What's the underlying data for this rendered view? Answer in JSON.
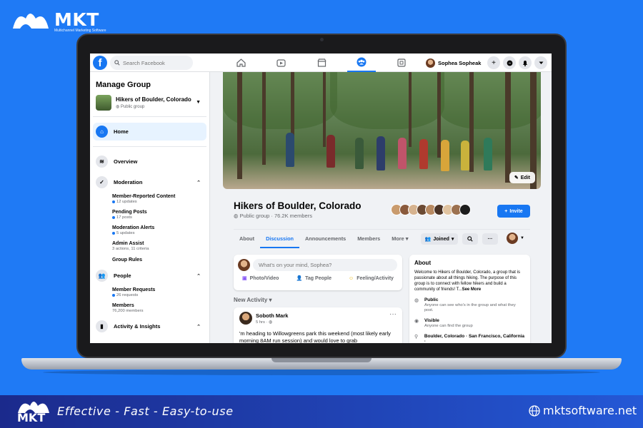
{
  "brand": {
    "name": "MKT",
    "sub": "Multichannel Marketing Software",
    "tagline": "Effective - Fast - Easy-to-use",
    "site": "mktsoftware.net"
  },
  "colors": {
    "background": "#1f7af5",
    "facebook_blue": "#1877f2",
    "footer_start": "#1b2a8c",
    "footer_end": "#2458d6"
  },
  "topbar": {
    "logo": "f",
    "search_placeholder": "Search Facebook",
    "nav_icons": [
      "home-icon",
      "watch-icon",
      "marketplace-icon",
      "groups-icon",
      "gaming-icon"
    ],
    "active_nav": "groups-icon",
    "user_name": "Sophea Sopheak",
    "actions": [
      "plus-icon",
      "messenger-icon",
      "bell-icon",
      "caret-icon"
    ]
  },
  "sidebar": {
    "title": "Manage Group",
    "group": {
      "name": "Hikers of Boulder, Colorado",
      "privacy": "Public group"
    },
    "home": "Home",
    "overview": "Overview",
    "moderation": {
      "label": "Moderation",
      "items": [
        {
          "label": "Member-Reported Content",
          "meta": "12 updates",
          "dot": true
        },
        {
          "label": "Pending Posts",
          "meta": "17 posts",
          "dot": true
        },
        {
          "label": "Moderation Alerts",
          "meta": "5 updates",
          "dot": true
        },
        {
          "label": "Admin Assist",
          "meta": "3 actions, 11 criteria",
          "dot": false
        },
        {
          "label": "Group Rules",
          "meta": "",
          "dot": false
        }
      ]
    },
    "people": {
      "label": "People",
      "items": [
        {
          "label": "Member Requests",
          "meta": "26 requests",
          "dot": true
        },
        {
          "label": "Members",
          "meta": "76,200 members",
          "dot": false
        }
      ]
    },
    "activity": "Activity & Insights"
  },
  "group": {
    "edit_label": "Edit",
    "name": "Hikers of Boulder, Colorado",
    "meta": "Public group · 76.2K members",
    "invite_label": "Invite",
    "tabs": [
      "About",
      "Discussion",
      "Announcements",
      "Members",
      "More"
    ],
    "active_tab": "Discussion",
    "joined_label": "Joined"
  },
  "composer": {
    "placeholder": "What's on your mind, Sophea?",
    "actions": [
      "Photo/Video",
      "Tag People",
      "Feeling/Activity"
    ]
  },
  "feed": {
    "heading": "New Activity",
    "post": {
      "author": "Soboth Mark",
      "time": "5 hrs · ",
      "text": "'m heading to Willowgreens park this weekend (most likely early morning 8AM run session) and would love to grab"
    }
  },
  "about": {
    "title": "About",
    "desc": "Welcome to Hikers of Boulder, Colorado, a group that is passionate about all things hiking. The purpose of this group is to connect with fellow hikers and build a community of friends! T...",
    "see_more": "See More",
    "public_title": "Public",
    "public_desc": "Anyone can see who's in the group and what they post.",
    "visible_title": "Visible",
    "visible_desc": "Anyone can find the group",
    "location": "Boulder, Colorado · San Francisco, California ·"
  }
}
